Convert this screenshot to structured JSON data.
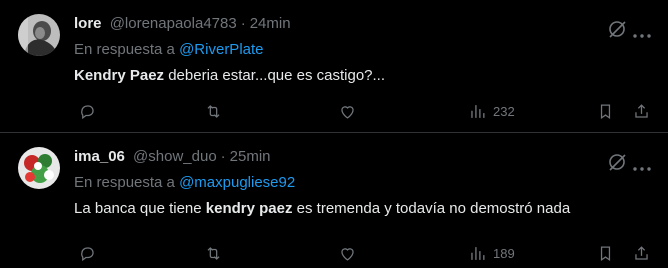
{
  "tweets": [
    {
      "name": "lore",
      "handle": "@lorenapaola4783",
      "separator": "·",
      "time": "24min",
      "reply_prefix": "En respuesta a",
      "reply_to": "@RiverPlate",
      "text_bold": "Kendry Paez",
      "text_after": " deberia estar...que es castigo?...",
      "views": "232",
      "avatar_style": "grayscale-photo"
    },
    {
      "name": "ima_06",
      "handle": "@show_duo",
      "separator": "·",
      "time": "25min",
      "reply_prefix": "En respuesta a",
      "reply_to": "@maxpugliese92",
      "text_before": "La banca que tiene ",
      "text_bold": "kendry paez",
      "text_after": " es tremenda y todavía no demostró nada",
      "views": "189",
      "avatar_style": "colorful-photo"
    }
  ],
  "icons": [
    "grok-icon",
    "more-icon",
    "reply-icon",
    "retweet-icon",
    "like-icon",
    "views-icon",
    "bookmark-icon",
    "share-icon"
  ],
  "colors": {
    "background": "#000000",
    "text": "#e7e9ea",
    "muted": "#71767b",
    "link": "#1d9bf0",
    "border": "#2f3336"
  }
}
